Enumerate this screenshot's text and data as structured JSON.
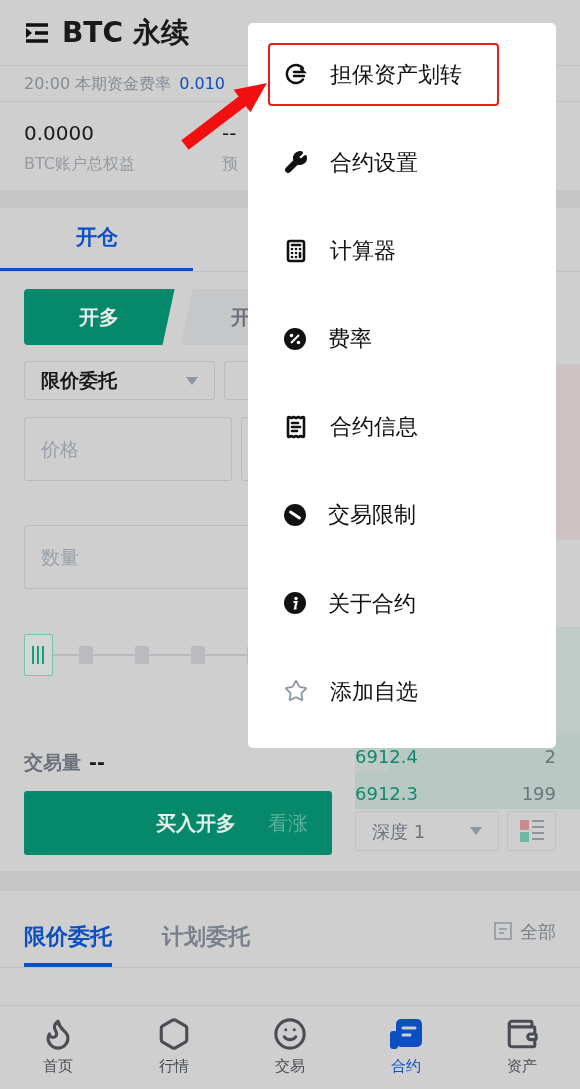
{
  "header": {
    "title": "BTC 永续"
  },
  "funding": {
    "label": "20:00 本期资金费率",
    "value": "0.010"
  },
  "stats": [
    {
      "value": "0.0000",
      "label": "BTC账户总权益"
    },
    {
      "value": "--",
      "label": "预"
    }
  ],
  "tabs": [
    {
      "label": "开仓",
      "selected": true
    }
  ],
  "side_toggle": [
    {
      "label": "开多",
      "selected": true
    },
    {
      "label": "开",
      "selected": false
    }
  ],
  "order_type": {
    "value": "限价委托"
  },
  "price_field": {
    "placeholder": "价格"
  },
  "quantity_field": {
    "placeholder": "数量"
  },
  "slider": {
    "level": 0
  },
  "volume": {
    "label": "交易量",
    "value": "--"
  },
  "buy_button": {
    "label": "买入开多",
    "hint": "看涨"
  },
  "order_book": {
    "bids": [
      {
        "price": "6912.4",
        "amount": "2",
        "level": 0.85
      },
      {
        "price": "6912.3",
        "amount": "199",
        "level": 1
      }
    ]
  },
  "depth_select": {
    "value": "深度 1"
  },
  "order_tabs": [
    {
      "label": "限价委托",
      "selected": true
    },
    {
      "label": "计划委托",
      "selected": false
    }
  ],
  "all_filter": {
    "label": "全部"
  },
  "bottom_nav": [
    {
      "label": "首页",
      "selected": false
    },
    {
      "label": "行情",
      "selected": false
    },
    {
      "label": "交易",
      "selected": false
    },
    {
      "label": "合约",
      "selected": true
    },
    {
      "label": "资产",
      "selected": false
    }
  ],
  "menu": {
    "items": [
      {
        "label": "担保资产划转",
        "highlighted": true
      },
      {
        "label": "合约设置",
        "highlighted": false
      },
      {
        "label": "计算器",
        "highlighted": false
      },
      {
        "label": "费率",
        "highlighted": false
      },
      {
        "label": "合约信息",
        "highlighted": false
      },
      {
        "label": "交易限制",
        "highlighted": false
      },
      {
        "label": "关于合约",
        "highlighted": false
      },
      {
        "label": "添加自选",
        "highlighted": false
      }
    ]
  }
}
